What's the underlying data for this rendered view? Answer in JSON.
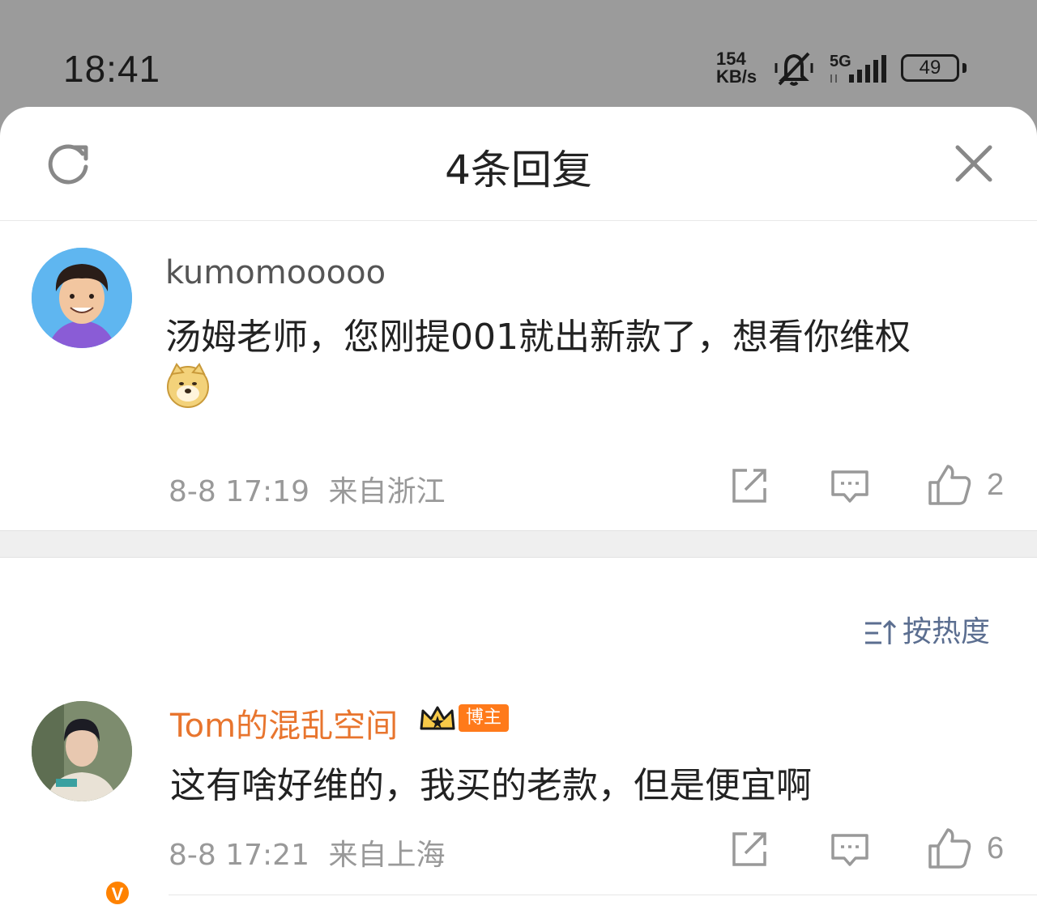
{
  "status_bar": {
    "time": "18:41",
    "net_speed_value": "154",
    "net_speed_unit": "KB/s",
    "network": "5G",
    "battery": "49"
  },
  "sheet": {
    "title": "4条回复"
  },
  "root_comment": {
    "username": "kumomooooo",
    "text_line1": "汤姆老师，您刚提001就出新款了，想看你维权",
    "emoji": "doge-emoji",
    "timestamp": "8-8 17:19",
    "location": "来自浙江",
    "like_count": "2"
  },
  "sort": {
    "label": "按热度"
  },
  "replies": [
    {
      "username": "Tom的混乱空间",
      "badge": "博主",
      "verified": "V",
      "text": "这有啥好维的，我买的老款，但是便宜啊",
      "timestamp": "8-8 17:21",
      "location": "来自上海",
      "like_count": "6"
    }
  ],
  "colors": {
    "accent_orange": "#e8752e",
    "sort_blue": "#5b6e90",
    "meta_gray": "#999999"
  }
}
